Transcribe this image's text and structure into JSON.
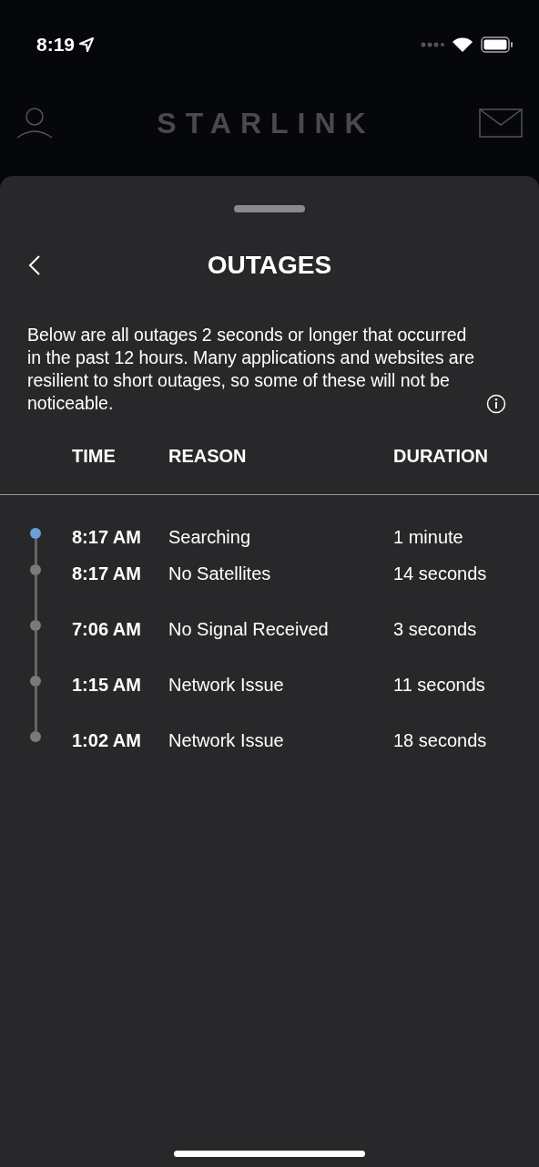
{
  "status_bar": {
    "time": "8:19"
  },
  "header": {
    "title": "STARLINK"
  },
  "sheet": {
    "title": "OUTAGES",
    "description": "Below are all outages 2 seconds or longer that occurred in the past 12 hours. Many applications and websites are resilient to short outages, so some of these will not be noticeable.",
    "columns": [
      "TIME",
      "REASON",
      "DURATION"
    ],
    "rows": [
      {
        "time": "8:17 AM",
        "reason": "Searching",
        "duration": "1 minute",
        "color": "#6a9fd8"
      },
      {
        "time": "8:17 AM",
        "reason": "No Satellites",
        "duration": "14 seconds",
        "color": "#7a7a7a"
      },
      {
        "time": "7:06 AM",
        "reason": "No Signal Received",
        "duration": "3 seconds",
        "color": "#7a7a7a"
      },
      {
        "time": "1:15 AM",
        "reason": "Network Issue",
        "duration": "11 seconds",
        "color": "#7a7a7a"
      },
      {
        "time": "1:02 AM",
        "reason": "Network Issue",
        "duration": "18 seconds",
        "color": "#7a7a7a"
      }
    ]
  }
}
